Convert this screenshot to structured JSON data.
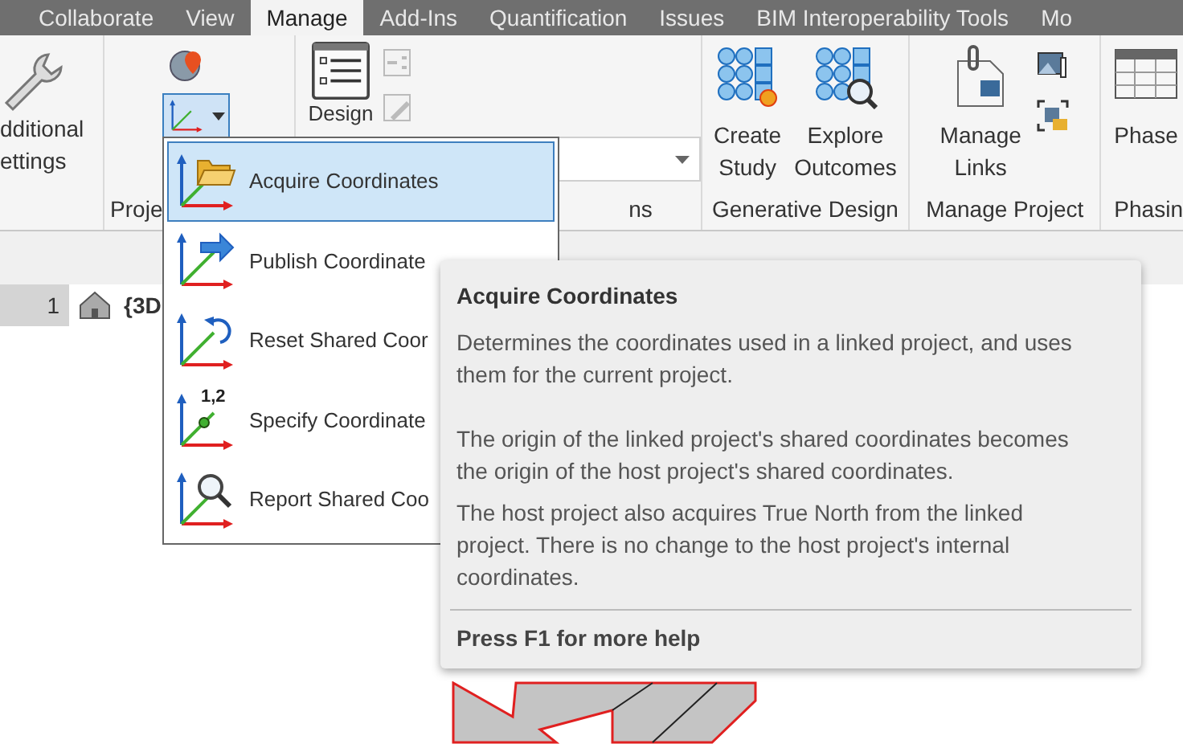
{
  "tabs": [
    {
      "label": "Collaborate",
      "selected": false
    },
    {
      "label": "View",
      "selected": false
    },
    {
      "label": "Manage",
      "selected": true
    },
    {
      "label": "Add-Ins",
      "selected": false
    },
    {
      "label": "Quantification",
      "selected": false
    },
    {
      "label": "Issues",
      "selected": false
    },
    {
      "label": "BIM Interoperability Tools",
      "selected": false
    },
    {
      "label": "Mo",
      "selected": false
    }
  ],
  "ribbon": {
    "settings": {
      "lines": [
        "dditional",
        "ettings"
      ]
    },
    "project_location": {
      "label": "Proje"
    },
    "design_panel": {
      "button": "Design",
      "label": "ns"
    },
    "generative_design": {
      "buttons": [
        {
          "kind": "create",
          "lines": [
            "Create",
            "Study"
          ]
        },
        {
          "kind": "explore",
          "lines": [
            "Explore",
            "Outcomes"
          ]
        }
      ],
      "label": "Generative Design"
    },
    "manage_project": {
      "lines": [
        "Manage",
        "Links"
      ],
      "label": "Manage Project"
    },
    "phasing": {
      "button": "Phase",
      "label": "Phasin"
    }
  },
  "view_tabs": [
    {
      "label": "1",
      "selected": false
    },
    {
      "label": "{3D",
      "selected": true
    }
  ],
  "menu": {
    "items": [
      {
        "kind": "acquire",
        "label": "Acquire Coordinates",
        "selected": true
      },
      {
        "kind": "publish",
        "label": "Publish Coordinate",
        "selected": false
      },
      {
        "kind": "reset",
        "label": "Reset Shared Coor",
        "selected": false
      },
      {
        "kind": "specify",
        "label": "Specify Coordinate",
        "badge": "1,2",
        "selected": false
      },
      {
        "kind": "report",
        "label": "Report Shared Coo",
        "selected": false
      }
    ]
  },
  "tooltip": {
    "title": "Acquire Coordinates",
    "paragraphs": [
      "Determines the coordinates used in a linked project, and uses them for the current project.",
      "The origin of the linked project's shared coordinates becomes the origin of the host project's shared coordinates.",
      "The host project also acquires True North from the linked project. There is no change to the host project's internal coordinates."
    ],
    "footer": "Press F1 for more help"
  }
}
